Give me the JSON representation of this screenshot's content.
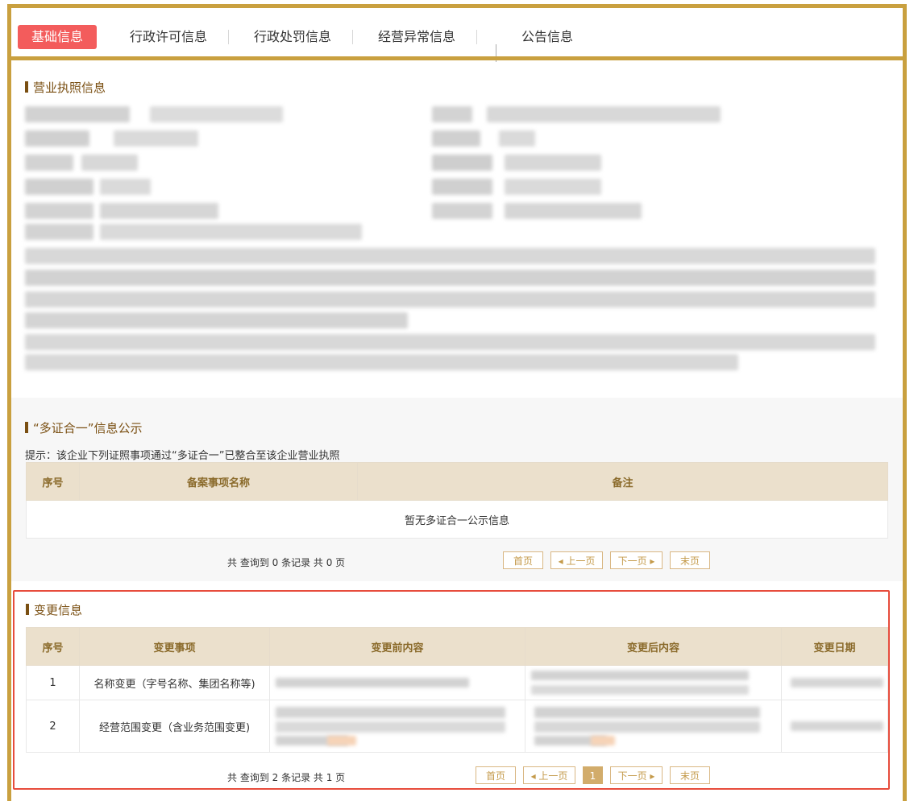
{
  "tabs": [
    {
      "label": "基础信息",
      "active": true
    },
    {
      "label": "行政许可信息"
    },
    {
      "label": "行政处罚信息"
    },
    {
      "label": "经营异常信息"
    },
    {
      "label": "公告信息"
    }
  ],
  "license": {
    "title": "营业执照信息"
  },
  "multi_cert": {
    "title": "“多证合一”信息公示",
    "hint": "提示：该企业下列证照事项通过“多证合一”已整合至该企业营业执照",
    "columns": [
      "序号",
      "备案事项名称",
      "备注"
    ],
    "empty_text": "暂无多证合一公示信息",
    "pager_summary": "共 查询到 0 条记录 共 0 页",
    "pager": {
      "first": "首页",
      "prev": "上一页",
      "next": "下一页",
      "last": "末页"
    }
  },
  "changes": {
    "title": "变更信息",
    "columns": [
      "序号",
      "变更事项",
      "变更前内容",
      "变更后内容",
      "变更日期"
    ],
    "rows": [
      {
        "index": "1",
        "item": "名称变更（字号名称、集团名称等)"
      },
      {
        "index": "2",
        "item": "经营范围变更（含业务范围变更)"
      }
    ],
    "pager_summary": "共 查询到 2 条记录 共 1 页",
    "pager": {
      "first": "首页",
      "prev": "上一页",
      "page": "1",
      "next": "下一页",
      "last": "末页"
    }
  },
  "colors": {
    "accent": "#c9a03f",
    "active_tab": "#f35c5c",
    "highlight_border": "#e74c3c"
  }
}
